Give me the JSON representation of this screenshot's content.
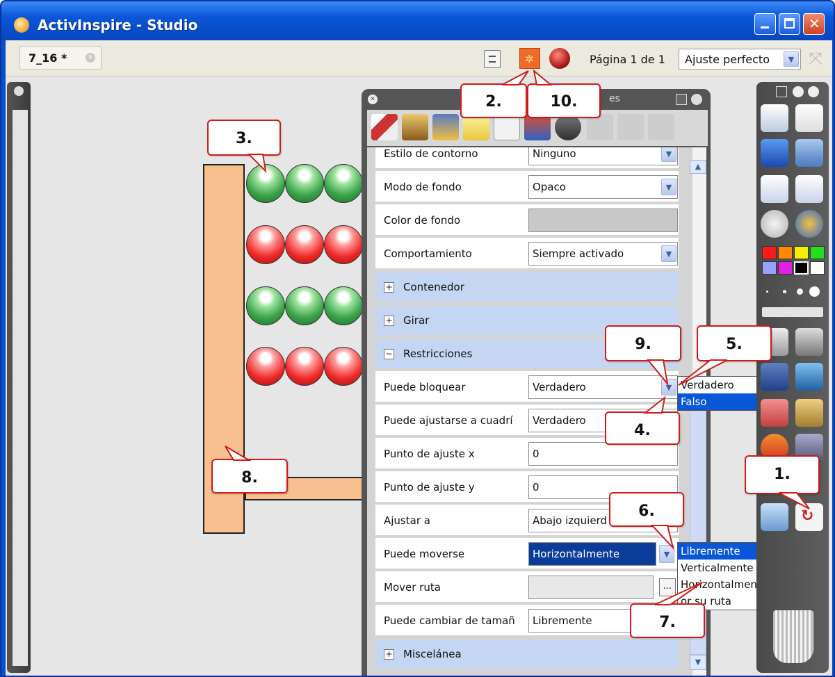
{
  "window": {
    "title": "ActivInspire - Studio"
  },
  "tabbar": {
    "doc_tab": "7_16 *",
    "page_indicator": "Página 1 de 1",
    "zoom": "Ajuste perfecto"
  },
  "properties": {
    "title": "es",
    "rows": {
      "outline_style": {
        "label": "Estilo de contorno",
        "value": "Ninguno"
      },
      "background_mode": {
        "label": "Modo de fondo",
        "value": "Opaco"
      },
      "background_color": {
        "label": "Color de fondo"
      },
      "behavior": {
        "label": "Comportamiento",
        "value": "Siempre activado"
      },
      "can_lock": {
        "label": "Puede bloquear",
        "value": "Verdadero"
      },
      "can_snap": {
        "label": "Puede ajustarse a cuadrí",
        "value": "Verdadero"
      },
      "snap_x": {
        "label": "Punto de ajuste x",
        "value": "0"
      },
      "snap_y": {
        "label": "Punto de ajuste y",
        "value": "0"
      },
      "snap_to": {
        "label": "Ajustar a",
        "value": "Abajo izquierd"
      },
      "can_move": {
        "label": "Puede moverse",
        "value": "Horizontalmente"
      },
      "move_path": {
        "label": "Mover ruta",
        "button": "..."
      },
      "can_resize": {
        "label": "Puede cambiar de tamañ",
        "value": "Libremente"
      }
    },
    "sections": {
      "container": "Contenedor",
      "rotate": "Girar",
      "restrictions": "Restricciones",
      "misc": "Miscelánea"
    }
  },
  "dropdown_lock": [
    "Verdadero",
    "Falso"
  ],
  "dropdown_move": [
    "Libremente",
    "Verticalmente",
    "Horizontalmente",
    "or su ruta"
  ],
  "callouts": [
    "1.",
    "2.",
    "3.",
    "4.",
    "5.",
    "6.",
    "7.",
    "8.",
    "9.",
    "10."
  ],
  "colors": {
    "accent": "#d01a1a",
    "titlebar": "#0a56d8",
    "section": "#c5d6f2",
    "selection": "#0a3c9a"
  }
}
